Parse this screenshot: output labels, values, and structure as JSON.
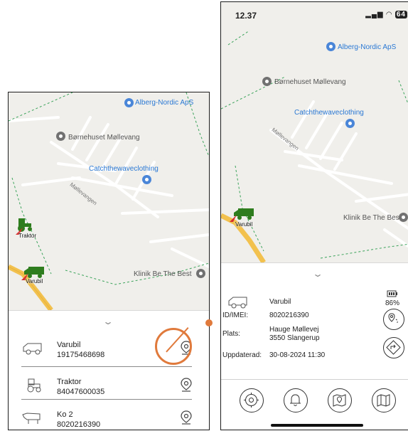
{
  "map_labels": {
    "alberg": "Alberg-Nordic ApS",
    "bornehuset": "Børnehuset Møllevang",
    "catchthewave": "Catchthewaveclothing",
    "road": "Møllevangen",
    "klinik": "Klinik Be The Best"
  },
  "phoneA": {
    "vehicles_on_map": [
      {
        "label": "Traktor",
        "icon": "tractor-icon",
        "color": "#2e7d1e"
      },
      {
        "label": "Varubil",
        "icon": "van-icon",
        "color": "#2e7d1e"
      }
    ],
    "vehicle_list": [
      {
        "name": "Varubil",
        "number": "19175468698",
        "icon": "van-outline-icon"
      },
      {
        "name": "Traktor",
        "number": "84047600035",
        "icon": "tractor-outline-icon"
      },
      {
        "name": "Ko 2",
        "number": "8020216390",
        "icon": "cow-outline-icon"
      }
    ]
  },
  "phoneB": {
    "status_time": "12.37",
    "battery_badge": "64",
    "vehicle_on_map": {
      "label": "Varubil",
      "icon": "van-icon"
    },
    "detail": {
      "name": "Varubil",
      "id_label": "ID/IMEI:",
      "id_value": "8020216390",
      "place_label": "Plats:",
      "place_line1": "Hauge Møllevej",
      "place_line2": "3550 Slangerup",
      "updated_label": "Uppdaterad:",
      "updated_value": "30-08-2024 11:30",
      "battery": "86%"
    },
    "nav": [
      "settings-gear-icon",
      "bell-icon",
      "map-pin-route-icon",
      "map-icon"
    ]
  },
  "colors": {
    "accent_orange": "#e07a3c",
    "vehicle_green": "#2e7d1e",
    "poi_blue": "#4a86d8"
  }
}
